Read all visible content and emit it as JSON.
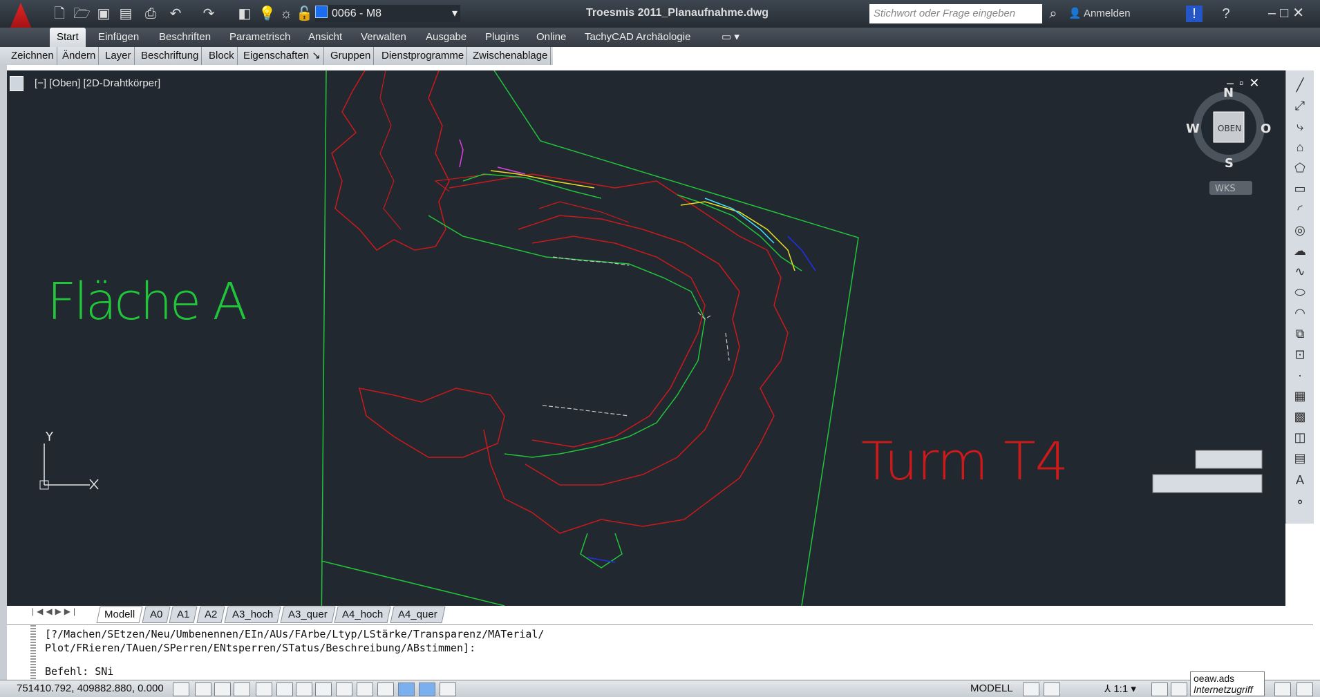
{
  "titlebar": {
    "layer_name": "0066 - M8",
    "doc_title": "Troesmis 2011_Planaufnahme.dwg",
    "search_placeholder": "Stichwort oder Frage eingeben",
    "signin_label": "Anmelden"
  },
  "ribbon": {
    "tabs": [
      "Start",
      "Einfügen",
      "Beschriften",
      "Parametrisch",
      "Ansicht",
      "Verwalten",
      "Ausgabe",
      "Plugins",
      "Online",
      "TachyCAD Archäologie"
    ],
    "panels": [
      "Zeichnen",
      "Ändern",
      "Layer",
      "Beschriftung",
      "Block",
      "Eigenschaften ↘",
      "Gruppen",
      "Dienstprogramme",
      "Zwischenablage"
    ]
  },
  "viewport": {
    "label": "[−] [Oben] [2D-Drahtkörper]",
    "compass": {
      "n": "N",
      "s": "S",
      "w": "W",
      "e": "O",
      "cube": "OBEN",
      "ucs": "WKS"
    },
    "text_flaeche": "Fläche   A",
    "text_turm": "Turm  T4",
    "axis_y": "Y"
  },
  "layout_tabs": [
    "Modell",
    "A0",
    "A1",
    "A2",
    "A3_hoch",
    "A3_quer",
    "A4_hoch",
    "A4_quer"
  ],
  "command": {
    "line1": "[?/Machen/SEtzen/Neu/Umbenennen/EIn/AUs/FArbe/Ltyp/LStärke/Transparenz/MATerial/",
    "line2": "Plot/FRieren/TAuen/SPerren/ENtsperren/STatus/Beschreibung/ABstimmen]:",
    "prompt": "Befehl: SNi"
  },
  "statusbar": {
    "coords": "751410.792, 409882.880, 0.000",
    "model": "MODELL",
    "scale": "1:1",
    "tooltip_title": "oeaw.ads",
    "tooltip_sub": "Internetzugriff"
  },
  "colors": {
    "viewport_bg": "#212830",
    "red": "#cc1a1a",
    "green": "#22c43a",
    "yellow": "#e8e020",
    "magenta": "#e040e0",
    "cyan": "#40e0ff",
    "blue": "#2030d0"
  }
}
